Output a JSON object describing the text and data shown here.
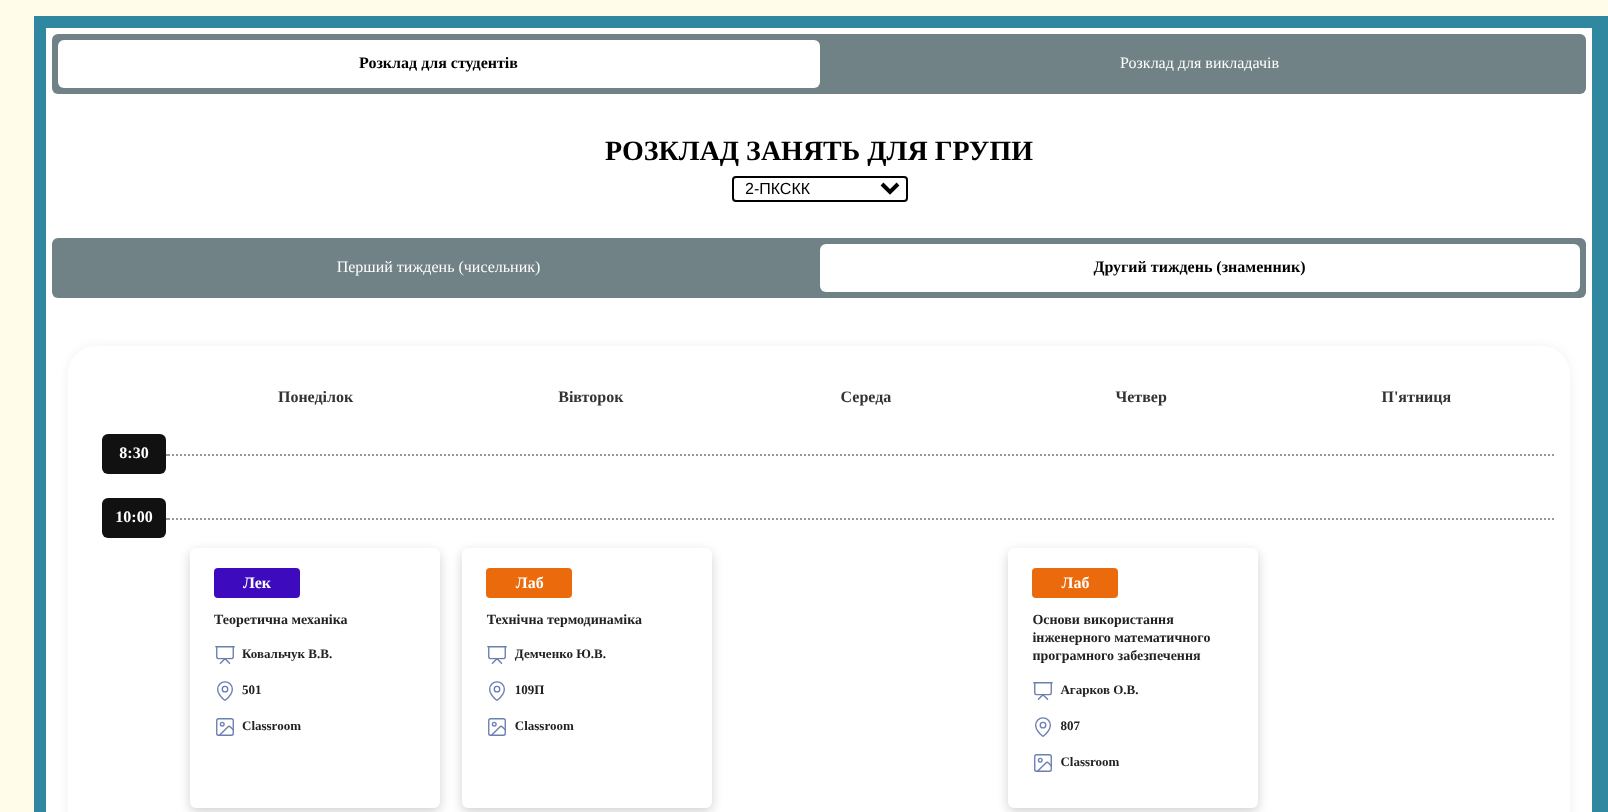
{
  "top_tabs": [
    {
      "label": "Розклад для студентів",
      "selected": true
    },
    {
      "label": "Розклад для викладачів",
      "selected": false
    }
  ],
  "heading": "РОЗКЛАД ЗАНЯТЬ ДЛЯ ГРУПИ",
  "group_select": {
    "value": "2-ПКСКК"
  },
  "week_tabs": [
    {
      "label": "Перший тиждень (чисельник)",
      "selected": false
    },
    {
      "label": "Другий тиждень (знаменник)",
      "selected": true
    }
  ],
  "schedule": {
    "days": [
      "Понеділок",
      "Вівторок",
      "Середа",
      "Четвер",
      "П'ятниця"
    ],
    "time_slots": [
      {
        "time": "8:30",
        "cells": [
          null,
          null,
          null,
          null,
          null
        ]
      },
      {
        "time": "10:00",
        "cells": [
          {
            "type": {
              "label": "Лек",
              "color": "#3d0bbd"
            },
            "title": "Теоретична механіка",
            "teacher": "Ковальчук В.В.",
            "room": "501",
            "platform": "Classroom"
          },
          {
            "type": {
              "label": "Лаб",
              "color": "#ea6a0c"
            },
            "title": "Технічна термодинаміка",
            "teacher": "Демченко Ю.В.",
            "room": "109П",
            "platform": "Classroom"
          },
          null,
          {
            "type": {
              "label": "Лаб",
              "color": "#ea6a0c"
            },
            "title": "Основи використання інженерного математичного програмного забезпечення",
            "teacher": "Агарков О.В.",
            "room": "807",
            "platform": "Classroom"
          },
          null
        ]
      }
    ]
  }
}
